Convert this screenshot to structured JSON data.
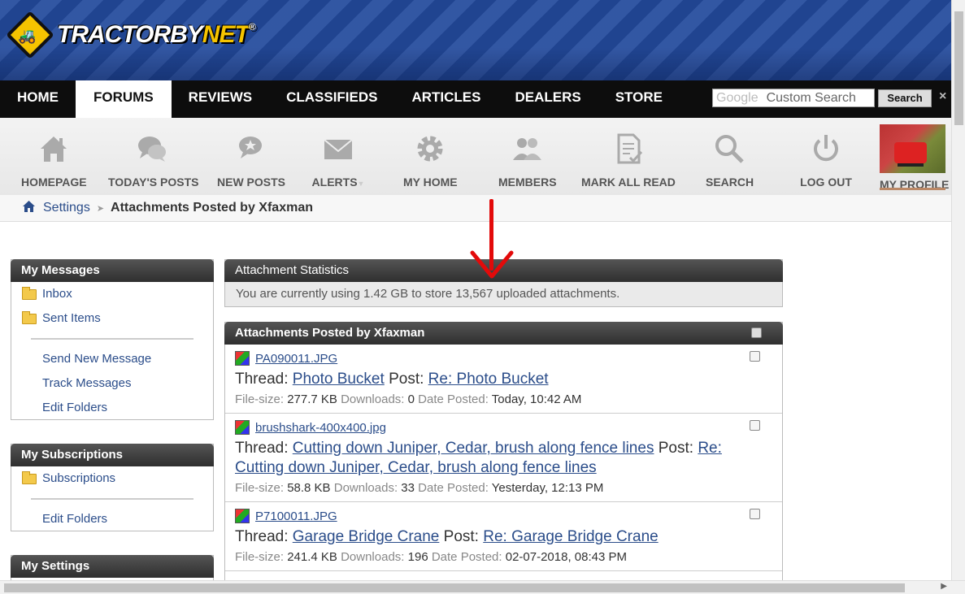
{
  "logo": {
    "text_main": "TRACTORBY",
    "text_net": "NET",
    "trademark": "®"
  },
  "topnav": {
    "items": [
      "HOME",
      "FORUMS",
      "REVIEWS",
      "CLASSIFIEDS",
      "ARTICLES",
      "DEALERS",
      "STORE"
    ],
    "active": "FORUMS",
    "search_brand": "Google",
    "search_placeholder": "Custom Search",
    "search_button": "Search",
    "close": "×"
  },
  "toolbar": {
    "items": [
      {
        "label": "HOMEPAGE",
        "icon": "house-icon"
      },
      {
        "label": "TODAY'S POSTS",
        "icon": "chat-bubbles-icon"
      },
      {
        "label": "NEW POSTS",
        "icon": "new-chat-icon"
      },
      {
        "label": "ALERTS",
        "icon": "envelope-icon"
      },
      {
        "label": "MY HOME",
        "icon": "gear-icon"
      },
      {
        "label": "MEMBERS",
        "icon": "people-icon"
      },
      {
        "label": "MARK ALL READ",
        "icon": "checklist-icon"
      },
      {
        "label": "SEARCH",
        "icon": "magnifier-icon"
      },
      {
        "label": "LOG OUT",
        "icon": "power-icon"
      },
      {
        "label": "MY PROFILE",
        "icon": "profile-photo"
      }
    ]
  },
  "breadcrumb": {
    "parent": "Settings",
    "current": "Attachments Posted by Xfaxman"
  },
  "sidebar": {
    "messages": {
      "title": "My Messages",
      "inbox": "Inbox",
      "sent": "Sent Items",
      "send_new": "Send New Message",
      "track": "Track Messages",
      "edit_folders": "Edit Folders"
    },
    "subscriptions": {
      "title": "My Subscriptions",
      "subscriptions": "Subscriptions",
      "edit_folders": "Edit Folders"
    },
    "settings": {
      "title": "My Settings"
    }
  },
  "stats": {
    "title": "Attachment Statistics",
    "text": "You are currently using 1.42 GB to store 13,567 uploaded attachments."
  },
  "attachments": {
    "title": "Attachments Posted by Xfaxman",
    "labels": {
      "thread": "Thread:",
      "post": "Post:",
      "filesize": "File-size:",
      "downloads": "Downloads:",
      "date": "Date Posted:"
    },
    "rows": [
      {
        "file": "PA090011.JPG",
        "thread": "Photo Bucket",
        "post": "Re: Photo Bucket",
        "size": "277.7 KB",
        "downloads": "0",
        "date": "Today, 10:42 AM"
      },
      {
        "file": "brushshark-400x400.jpg",
        "thread": "Cutting down Juniper, Cedar, brush along fence lines",
        "post": "Re: Cutting down Juniper, Cedar, brush along fence lines",
        "size": "58.8 KB",
        "downloads": "33",
        "date": "Yesterday, 12:13 PM"
      },
      {
        "file": "P7100011.JPG",
        "thread": "Garage Bridge Crane",
        "post": "Re: Garage Bridge Crane",
        "size": "241.4 KB",
        "downloads": "196",
        "date": "02-07-2018, 08:43 PM"
      }
    ]
  },
  "colors": {
    "link": "#2b4d8a",
    "header_blue": "#234a9c",
    "nav_black": "#0d0d0d",
    "accent_yellow": "#f6c400",
    "annotation_red": "#e30a0a"
  }
}
